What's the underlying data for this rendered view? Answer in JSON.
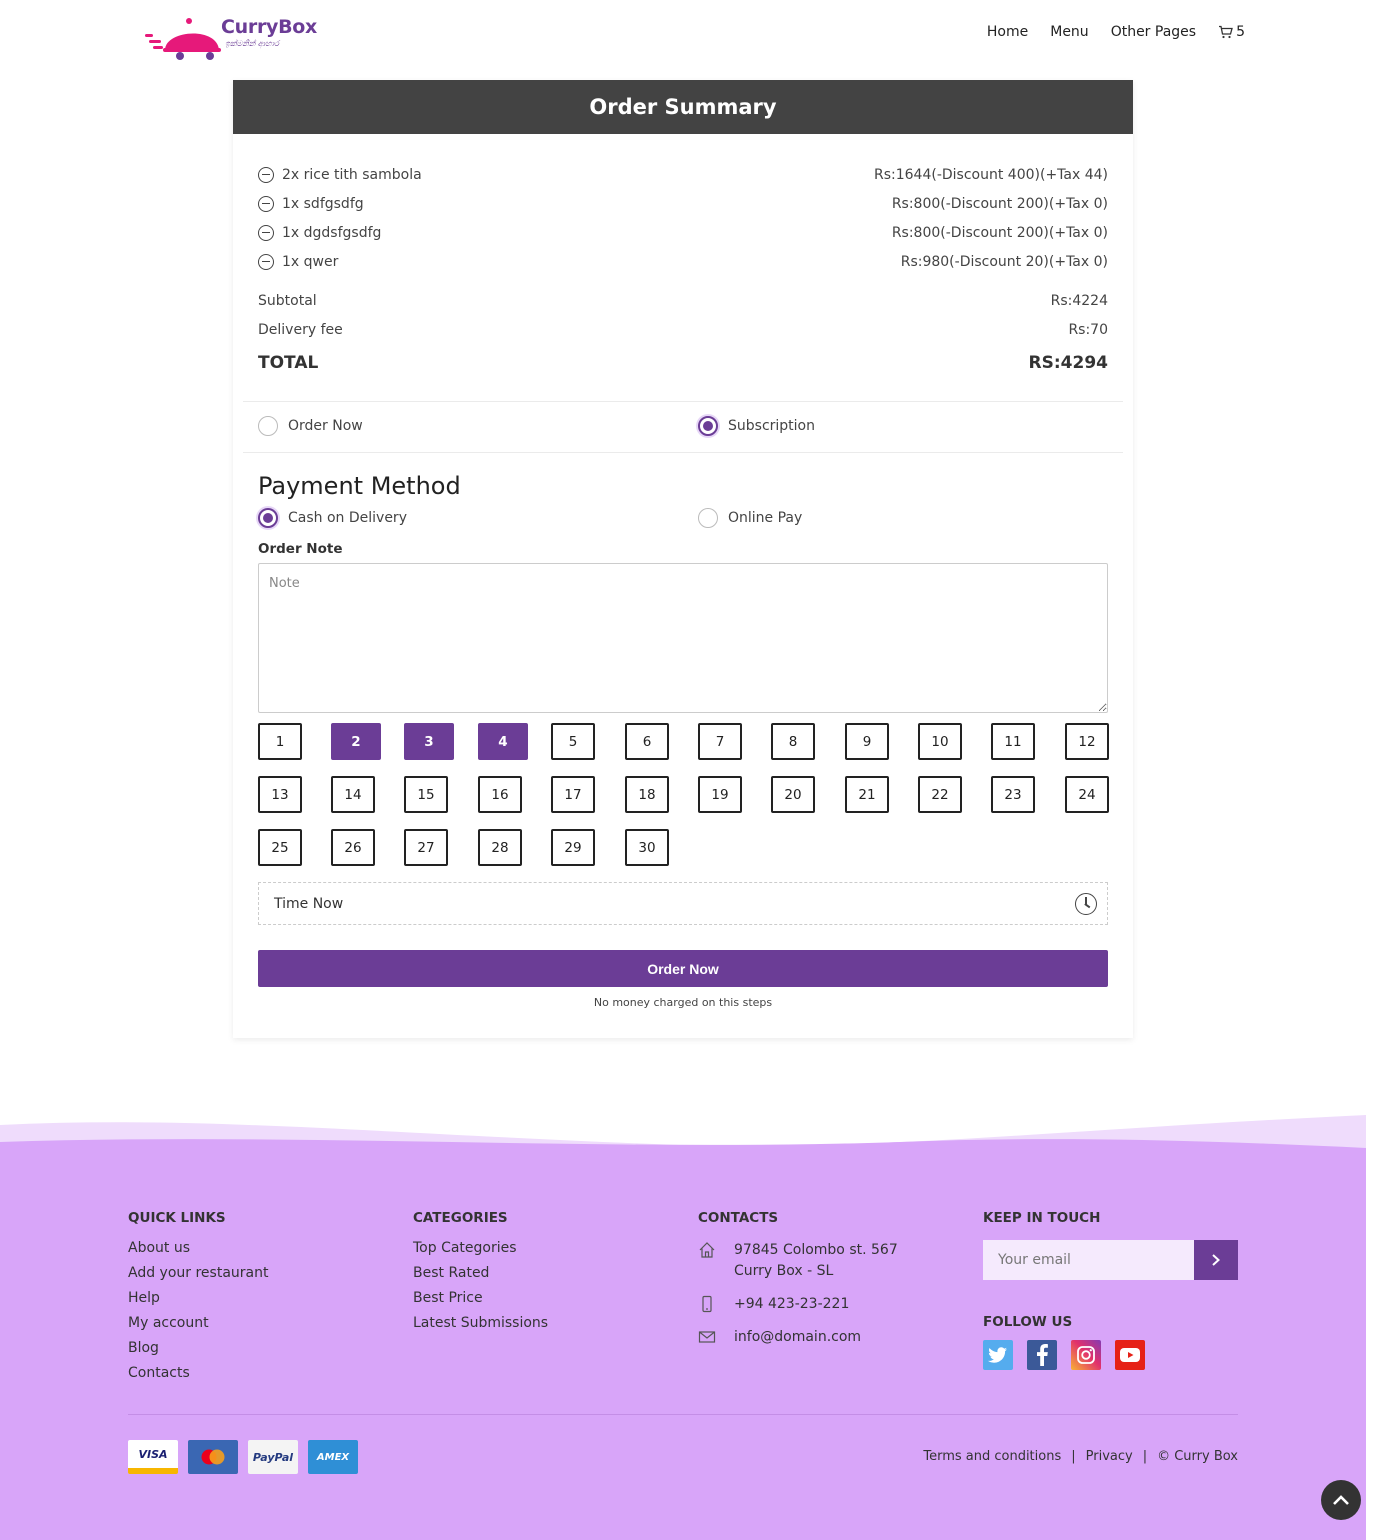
{
  "header": {
    "brand": "CurryBox",
    "tagline": "ඉක්මනින් ආහාර",
    "nav": [
      "Home",
      "Menu",
      "Other Pages"
    ],
    "cart_count": "5"
  },
  "summary": {
    "title": "Order Summary",
    "items": [
      {
        "name": "2x rice tith sambola",
        "price": "Rs:1644(-Discount 400)(+Tax 44)"
      },
      {
        "name": "1x sdfgsdfg",
        "price": "Rs:800(-Discount 200)(+Tax 0)"
      },
      {
        "name": "1x dgdsfgsdfg",
        "price": "Rs:800(-Discount 200)(+Tax 0)"
      },
      {
        "name": "1x qwer",
        "price": "Rs:980(-Discount 20)(+Tax 0)"
      }
    ],
    "subtotal_label": "Subtotal",
    "subtotal_value": "Rs:4224",
    "delivery_label": "Delivery fee",
    "delivery_value": "Rs:70",
    "total_label": "TOTAL",
    "total_value": "RS:4294"
  },
  "order_type": {
    "options": [
      "Order Now",
      "Subscription"
    ],
    "selected": "Subscription"
  },
  "payment": {
    "title": "Payment Method",
    "options": [
      "Cash on Delivery",
      "Online Pay"
    ],
    "selected": "Cash on Delivery"
  },
  "note": {
    "label": "Order Note",
    "placeholder": "Note",
    "value": ""
  },
  "days": {
    "values": [
      "1",
      "2",
      "3",
      "4",
      "5",
      "6",
      "7",
      "8",
      "9",
      "10",
      "11",
      "12",
      "13",
      "14",
      "15",
      "16",
      "17",
      "18",
      "19",
      "20",
      "21",
      "22",
      "23",
      "24",
      "25",
      "26",
      "27",
      "28",
      "29",
      "30"
    ],
    "selected": [
      "2",
      "3",
      "4"
    ]
  },
  "time": {
    "label": "Time Now"
  },
  "order_button": "Order Now",
  "no_money_note": "No money charged on this steps",
  "footer": {
    "quick_links_title": "QUICK LINKS",
    "quick_links": [
      "About us",
      "Add your restaurant",
      "Help",
      "My account",
      "Blog",
      "Contacts"
    ],
    "categories_title": "CATEGORIES",
    "categories": [
      "Top Categories",
      "Best Rated",
      "Best Price",
      "Latest Submissions"
    ],
    "contacts_title": "CONTACTS",
    "address_line1": "97845 Colombo st. 567",
    "address_line2": "Curry Box - SL",
    "phone": "+94 423-23-221",
    "email": "info@domain.com",
    "keep_title": "KEEP IN TOUCH",
    "email_placeholder": "Your email",
    "follow_title": "FOLLOW US",
    "payment_cards": [
      "VISA",
      "",
      "PayPal",
      "AMEX"
    ],
    "terms": "Terms and conditions",
    "privacy": "Privacy",
    "copyright": "© Curry Box"
  },
  "colors": {
    "accent": "#6b3d96",
    "header_bar": "#434343",
    "footer_bg": "#d8a5f9",
    "logo_pink": "#e6197a"
  }
}
